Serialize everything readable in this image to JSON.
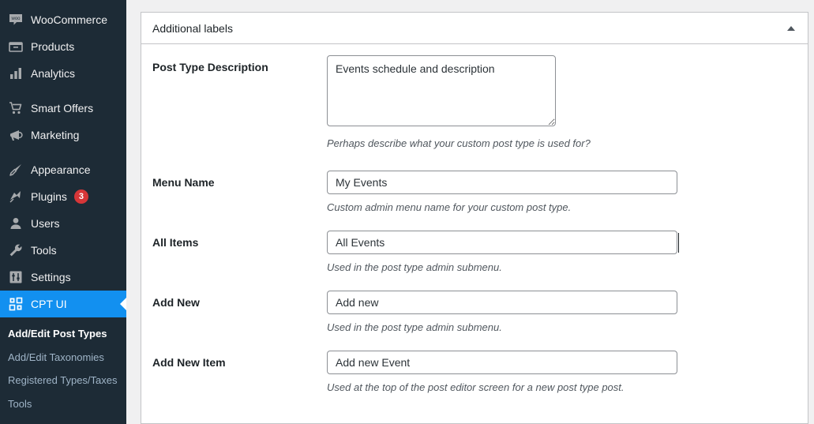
{
  "sidebar": {
    "groups": [
      {
        "items": [
          {
            "label": "WooCommerce",
            "icon": "woocommerce-icon",
            "name": "sidebar-item-woocommerce",
            "active": false
          },
          {
            "label": "Products",
            "icon": "products-icon",
            "name": "sidebar-item-products",
            "active": false
          },
          {
            "label": "Analytics",
            "icon": "analytics-icon",
            "name": "sidebar-item-analytics",
            "active": false
          }
        ]
      },
      {
        "items": [
          {
            "label": "Smart Offers",
            "icon": "cart-icon",
            "name": "sidebar-item-smart-offers",
            "active": false
          },
          {
            "label": "Marketing",
            "icon": "megaphone-icon",
            "name": "sidebar-item-marketing",
            "active": false
          }
        ]
      },
      {
        "items": [
          {
            "label": "Appearance",
            "icon": "paintbrush-icon",
            "name": "sidebar-item-appearance",
            "active": false
          },
          {
            "label": "Plugins",
            "icon": "plug-icon",
            "name": "sidebar-item-plugins",
            "active": false,
            "badge": "3"
          },
          {
            "label": "Users",
            "icon": "user-icon",
            "name": "sidebar-item-users",
            "active": false
          },
          {
            "label": "Tools",
            "icon": "wrench-icon",
            "name": "sidebar-item-tools",
            "active": false
          },
          {
            "label": "Settings",
            "icon": "sliders-icon",
            "name": "sidebar-item-settings",
            "active": false
          },
          {
            "label": "CPT UI",
            "icon": "cpt-ui-grid-icon",
            "name": "sidebar-item-cpt-ui",
            "active": true
          }
        ]
      }
    ],
    "submenu": [
      {
        "label": "Add/Edit Post Types",
        "name": "submenu-item-add-edit-post-types",
        "current": true
      },
      {
        "label": "Add/Edit Taxonomies",
        "name": "submenu-item-add-edit-taxonomies",
        "current": false
      },
      {
        "label": "Registered Types/Taxes",
        "name": "submenu-item-registered-types-taxes",
        "current": false
      },
      {
        "label": "Tools",
        "name": "submenu-item-tools",
        "current": false
      }
    ],
    "colors": {
      "background": "#1d2b36",
      "active": "#1290f0",
      "badge": "#d63638",
      "submenu_text": "#9fb4c7"
    }
  },
  "panel": {
    "title": "Additional labels",
    "toggle_icon": "collapse-triangle-icon",
    "fields": [
      {
        "label": "Post Type Description",
        "value": "Events schedule and description",
        "placeholder": "",
        "helper": "Perhaps describe what your custom post type is used for?",
        "type": "textarea",
        "name": "post-type-description"
      },
      {
        "label": "Menu Name",
        "value": "My Events",
        "placeholder": "",
        "helper": "Custom admin menu name for your custom post type.",
        "type": "text",
        "name": "menu-name"
      },
      {
        "label": "All Items",
        "value": "All Events",
        "placeholder": "",
        "helper": "Used in the post type admin submenu.",
        "type": "text",
        "name": "all-items",
        "focused": true
      },
      {
        "label": "Add New",
        "value": "Add new",
        "placeholder": "",
        "helper": "Used in the post type admin submenu.",
        "type": "text",
        "name": "add-new"
      },
      {
        "label": "Add New Item",
        "value": "Add new Event",
        "placeholder": "",
        "helper": "Used at the top of the post editor screen for a new post type post.",
        "type": "text",
        "name": "add-new-item"
      }
    ]
  }
}
